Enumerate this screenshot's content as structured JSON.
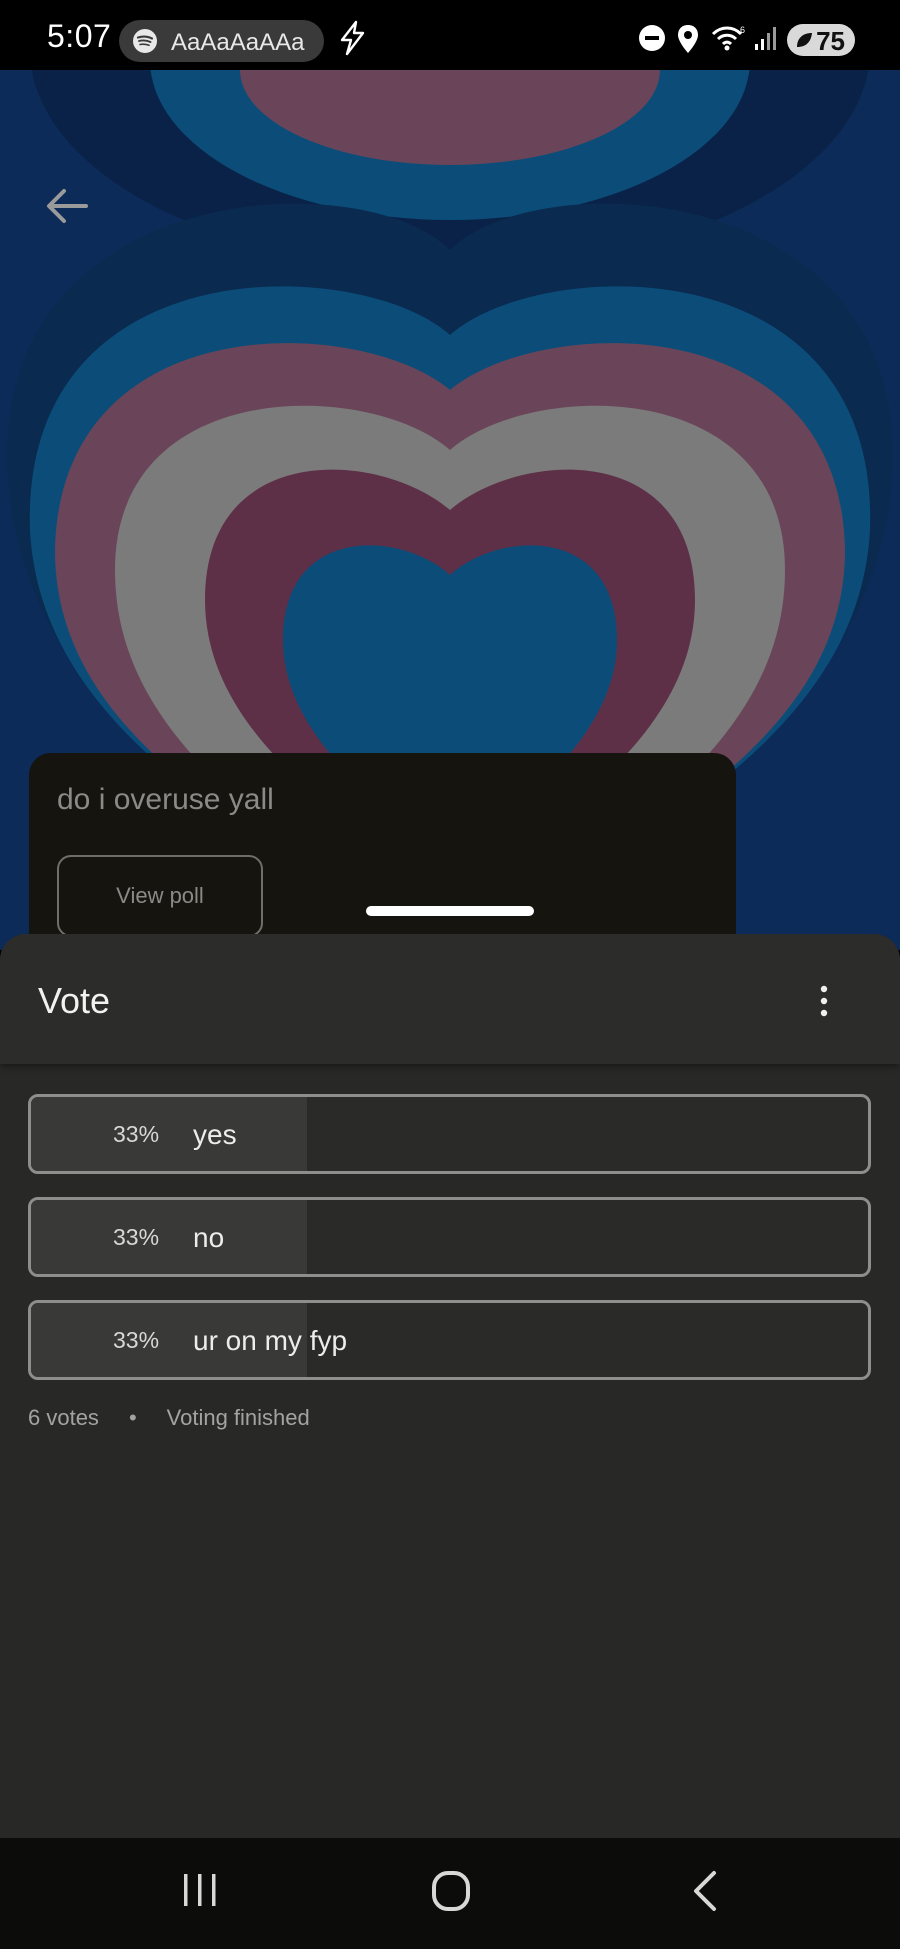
{
  "status_bar": {
    "time": "5:07",
    "media_text": "AaAaAaAAa",
    "battery": "75"
  },
  "post": {
    "title": "do i overuse yall",
    "view_poll_label": "View poll"
  },
  "sheet": {
    "title": "Vote",
    "options": [
      {
        "percent": "33%",
        "label": "yes",
        "fraction": 0.33
      },
      {
        "percent": "33%",
        "label": "no",
        "fraction": 0.33
      },
      {
        "percent": "33%",
        "label": "ur on my fyp",
        "fraction": 0.33
      }
    ],
    "votes": "6 votes",
    "separator": "•",
    "status": "Voting finished"
  },
  "icons": {
    "back": "arrow-left-icon",
    "more": "more-vertical-icon",
    "spotify": "spotify-icon",
    "bolt": "bolt-icon",
    "dnd": "do-not-disturb-icon",
    "location": "location-icon",
    "wifi": "wifi-icon",
    "signal": "signal-icon"
  },
  "colors": {
    "art_blue": "#0b2a57",
    "art_pink": "#6a4559",
    "art_grey": "#7b7b7b",
    "art_teal": "#0b4d78",
    "sheet_bg": "#282827"
  }
}
